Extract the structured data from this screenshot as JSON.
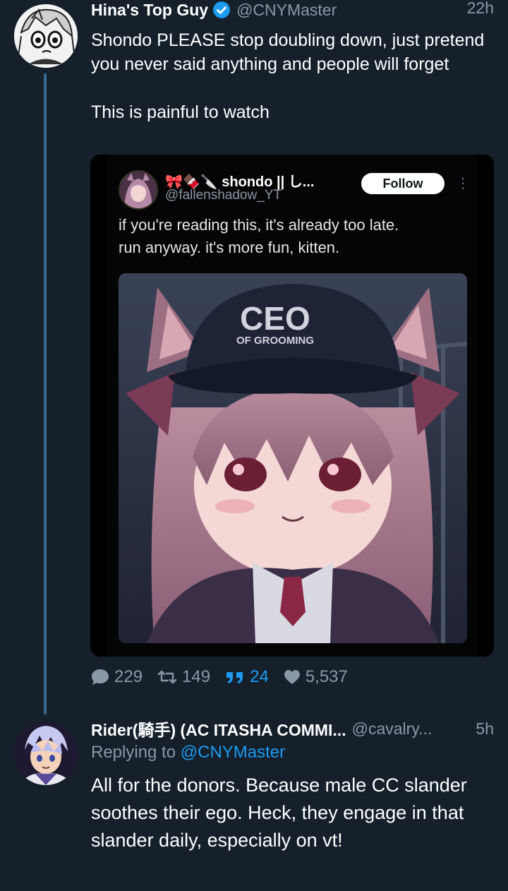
{
  "tweet": {
    "author_name": "Hina's Top Guy",
    "handle": "@CNYMaster",
    "time": "22h",
    "text_line1": "Shondo PLEASE stop doubling down, just pretend you never said anything and people will forget",
    "text_line2": "This is painful to watch",
    "embedded": {
      "name": "🎀🍫🔪 shondo || し...",
      "handle": "@fallenshadow_YT",
      "follow_label": "Follow",
      "more_icon": "⋮",
      "text_line1": "if you're reading this, it's already too late.",
      "text_line2": "run anyway. it's more fun, kitten.",
      "cap_text": "CEO",
      "cap_subtext": "OF GROOMING"
    },
    "stats": {
      "replies": "229",
      "retweets": "149",
      "quotes": "24",
      "likes": "5,537"
    }
  },
  "reply": {
    "author_name": "Rider(騎手) (AC ITASHA COMMI...",
    "handle": "@cavalry...",
    "time": "5h",
    "replying_prefix": "Replying to",
    "replying_to": "@CNYMaster",
    "text": "All for the donors. Because male CC slander soothes their ego. Heck, they engage in that slander daily, especially on vt!"
  },
  "colors": {
    "background": "#15202b",
    "accent": "#1d9bf0",
    "muted": "#8b98a5",
    "thread_line": "#3b6a8f"
  }
}
